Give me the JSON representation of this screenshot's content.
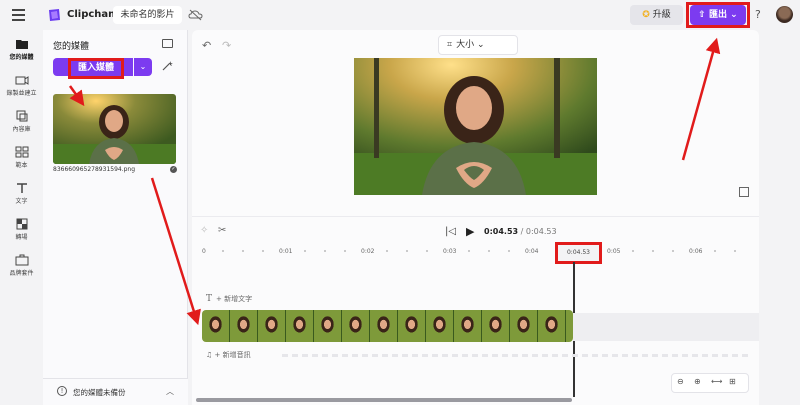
{
  "header": {
    "brand": "Clipchamp",
    "project_title": "未命名的影片",
    "upgrade_label": "升級",
    "export_label": "匯出",
    "help": "?"
  },
  "nav": [
    {
      "label": "您的媒體",
      "icon": "folder-icon"
    },
    {
      "label": "錄製並建立",
      "icon": "camera-icon"
    },
    {
      "label": "內容庫",
      "icon": "library-icon"
    },
    {
      "label": "範本",
      "icon": "templates-icon"
    },
    {
      "label": "文字",
      "icon": "text-icon"
    },
    {
      "label": "轉場",
      "icon": "transitions-icon"
    },
    {
      "label": "品牌套件",
      "icon": "brand-kit-icon"
    }
  ],
  "media": {
    "title": "您的媒體",
    "import_label": "匯入媒體",
    "file_name": "836660965278931594.png",
    "backup_text": "您的媒體未備份"
  },
  "preview": {
    "size_label": "大小"
  },
  "timeline": {
    "current_time": "0:04.53",
    "total_time": " / 0:04.53",
    "ruler": [
      "0",
      "0:01",
      "0:02",
      "0:03",
      "0:04",
      "0:05",
      "0:06"
    ],
    "playhead_label": "0:04.53",
    "add_text": "+ 新增文字",
    "add_audio": "+ 新增音訊"
  },
  "colors": {
    "accent": "#7c3bf0",
    "highlight": "#e11b1b"
  }
}
